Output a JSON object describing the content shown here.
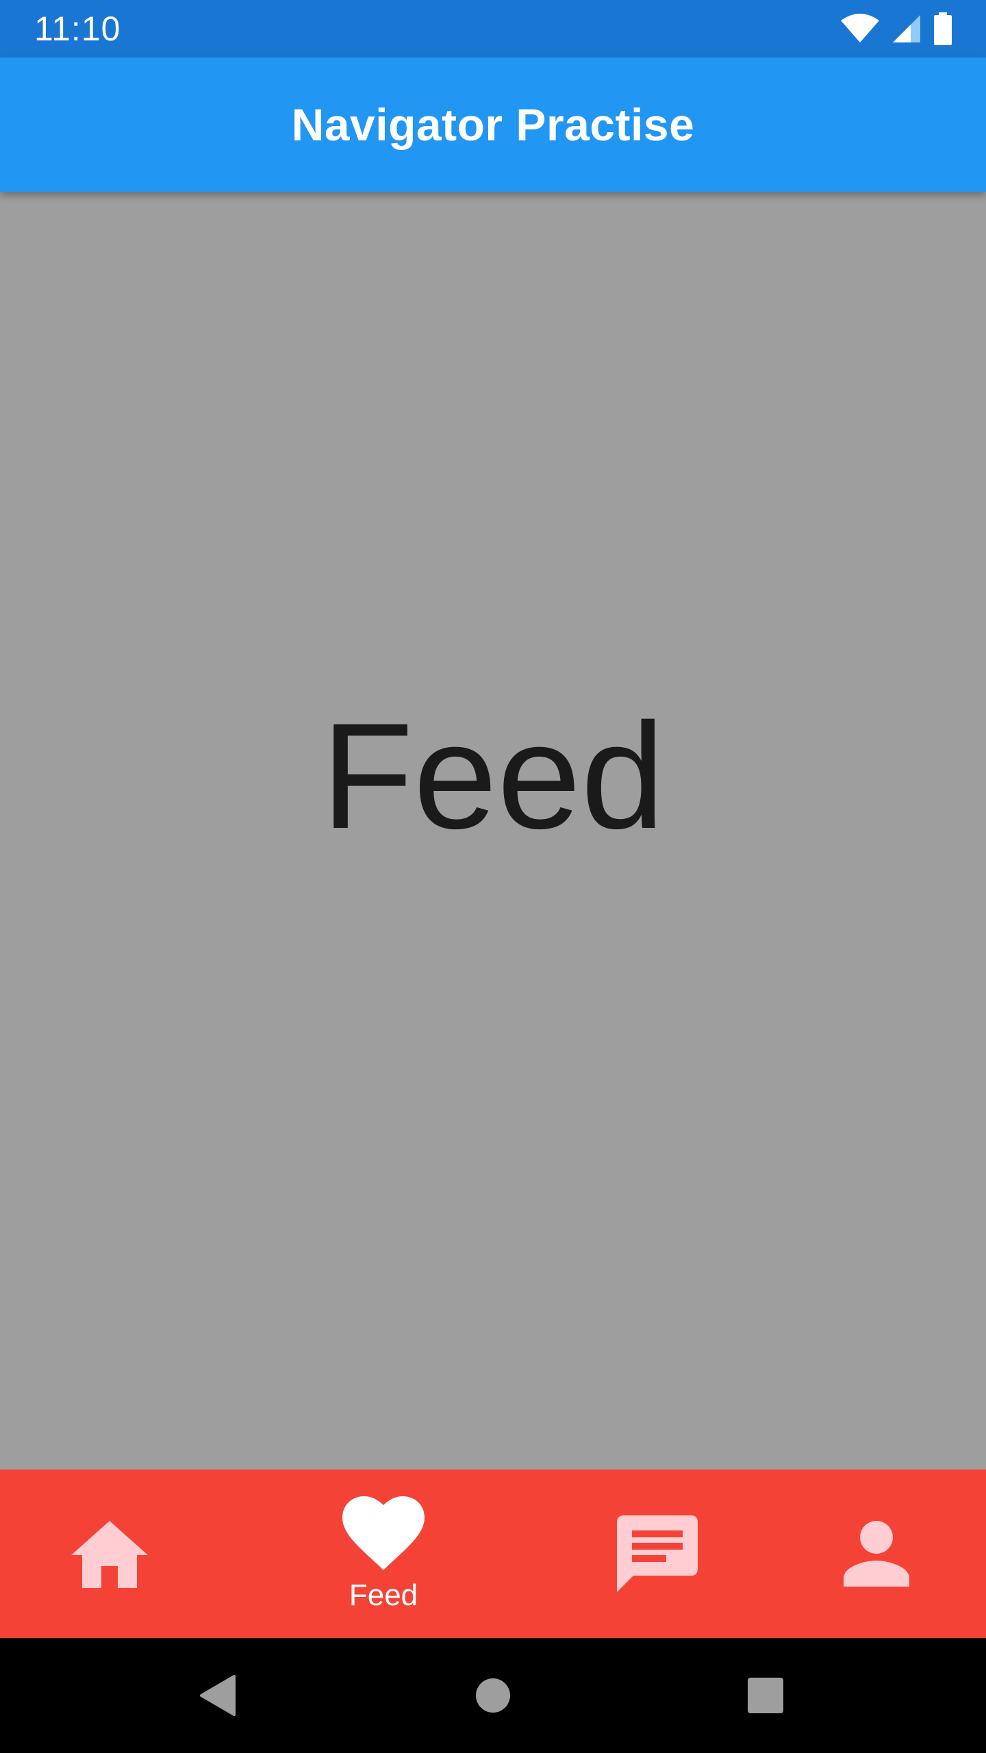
{
  "status_bar": {
    "time": "11:10",
    "icons": [
      "wifi-icon",
      "signal-icon",
      "battery-icon"
    ],
    "color": "#1976d2"
  },
  "app_bar": {
    "title": "Navigator Practise",
    "color": "#2196f3"
  },
  "content": {
    "text": "Feed",
    "background": "#9e9e9e"
  },
  "bottom_nav": {
    "background": "#f44336",
    "selected_index": 1,
    "items": [
      {
        "icon": "home-icon",
        "label": "",
        "selected": false
      },
      {
        "icon": "heart-icon",
        "label": "Feed",
        "selected": true
      },
      {
        "icon": "message-icon",
        "label": "",
        "selected": false
      },
      {
        "icon": "person-icon",
        "label": "",
        "selected": false
      }
    ],
    "selected_color": "#ffffff",
    "unselected_color": "#ffcdd2"
  },
  "system_nav": {
    "buttons": [
      "back-icon",
      "home-circle-icon",
      "recents-icon"
    ]
  }
}
